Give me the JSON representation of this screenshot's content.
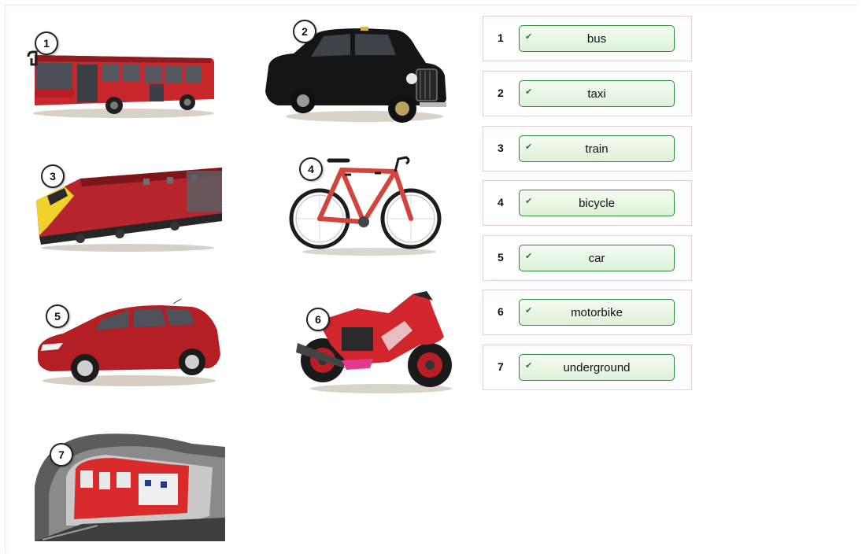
{
  "pictures": [
    {
      "number": "1",
      "icon": "bus-icon"
    },
    {
      "number": "2",
      "icon": "taxi-icon"
    },
    {
      "number": "3",
      "icon": "train-icon"
    },
    {
      "number": "4",
      "icon": "bicycle-icon"
    },
    {
      "number": "5",
      "icon": "car-icon"
    },
    {
      "number": "6",
      "icon": "motorbike-icon"
    },
    {
      "number": "7",
      "icon": "underground-icon"
    }
  ],
  "answers": [
    {
      "number": "1",
      "word": "bus",
      "check": "✔"
    },
    {
      "number": "2",
      "word": "taxi",
      "check": "✔"
    },
    {
      "number": "3",
      "word": "train",
      "check": "✔"
    },
    {
      "number": "4",
      "word": "bicycle",
      "check": "✔"
    },
    {
      "number": "5",
      "word": "car",
      "check": "✔"
    },
    {
      "number": "6",
      "word": "motorbike",
      "check": "✔"
    },
    {
      "number": "7",
      "word": "underground",
      "check": "✔"
    }
  ],
  "colors": {
    "correct_border": "#2e8b3a",
    "correct_fill": "#ddf2d8",
    "row_border": "#e6cdd3"
  }
}
